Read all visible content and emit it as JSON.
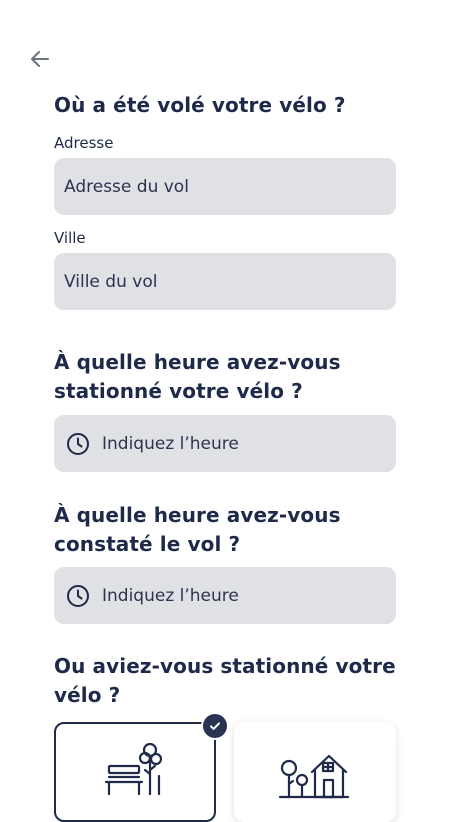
{
  "nav": {
    "back_icon": "arrow-left-icon"
  },
  "sections": {
    "theft_location": {
      "title": "Où a été volé votre vélo ?",
      "address": {
        "label": "Adresse",
        "placeholder": "Adresse du vol",
        "value": ""
      },
      "city": {
        "label": "Ville",
        "placeholder": "Ville du vol",
        "value": ""
      }
    },
    "parked_time": {
      "title": "À quelle heure avez-vous stationné votre vélo ?",
      "placeholder": "Indiquez l’heure",
      "icon": "clock-icon"
    },
    "noticed_time": {
      "title": "À quelle heure avez-vous constaté le vol ?",
      "placeholder": "Indiquez l’heure",
      "icon": "clock-icon"
    },
    "parking_place": {
      "title": "Ou aviez-vous stationné votre vélo ?",
      "options": [
        {
          "icon": "street-bench-tree-icon",
          "selected": true
        },
        {
          "icon": "house-tree-icon",
          "selected": false
        }
      ]
    }
  },
  "colors": {
    "text": "#1f2a4a",
    "field_bg": "#dfe1e5",
    "selected_border": "#1f2a4a",
    "check_badge": "#2a3352"
  }
}
